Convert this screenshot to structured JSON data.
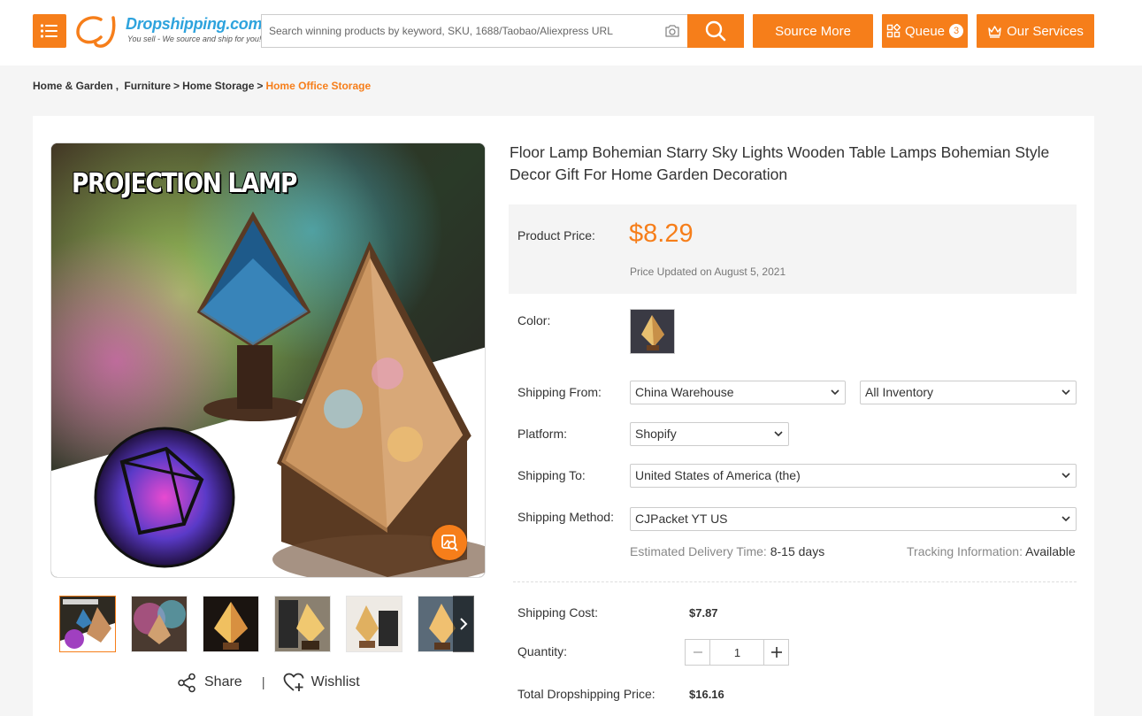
{
  "colors": {
    "accent": "#f67e1a",
    "logo_blue": "#2ea3dd"
  },
  "header": {
    "logo_brand": "Dropshipping.com",
    "logo_tagline": "You sell - We source and ship for you!",
    "search_placeholder": "Search winning products by keyword, SKU, 1688/Taobao/Aliexpress URL",
    "source_more_label": "Source More",
    "queue_label": "Queue",
    "queue_count": "3",
    "services_label": "Our Services",
    "icons": [
      "menu-icon",
      "camera-icon",
      "search-icon",
      "queue-icon",
      "crown-icon"
    ]
  },
  "breadcrumb": {
    "items": [
      "Home & Garden",
      "Furniture",
      "Home Storage"
    ],
    "separators": [
      ",",
      ">",
      ">"
    ],
    "current": "Home Office Storage"
  },
  "gallery": {
    "image_caption": "PROJECTION LAMP",
    "thumbnail_count": 6,
    "selected_index": 0
  },
  "actions": {
    "share_label": "Share",
    "divider": "|",
    "wishlist_label": "Wishlist"
  },
  "product": {
    "title": "Floor Lamp Bohemian Starry Sky Lights Wooden Table Lamps Bohemian Style Decor Gift For Home Garden Decoration",
    "price_label": "Product Price:",
    "price": "$8.29",
    "price_updated": "Price Updated on August 5, 2021",
    "color_label": "Color:",
    "shipping_from_label": "Shipping From:",
    "shipping_from_value": "China Warehouse",
    "inventory_value": "All Inventory",
    "platform_label": "Platform:",
    "platform_value": "Shopify",
    "shipping_to_label": "Shipping To:",
    "shipping_to_value": "United States of America (the)",
    "shipping_method_label": "Shipping Method:",
    "shipping_method_value": "CJPacket YT US",
    "delivery_label": "Estimated Delivery Time:",
    "delivery_value": "8-15 days",
    "tracking_label": "Tracking Information:",
    "tracking_value": "Available",
    "shipping_cost_label": "Shipping Cost:",
    "shipping_cost_value": "$7.87",
    "quantity_label": "Quantity:",
    "quantity_value": "1",
    "total_label": "Total Dropshipping Price:",
    "total_value": "$16.16"
  }
}
